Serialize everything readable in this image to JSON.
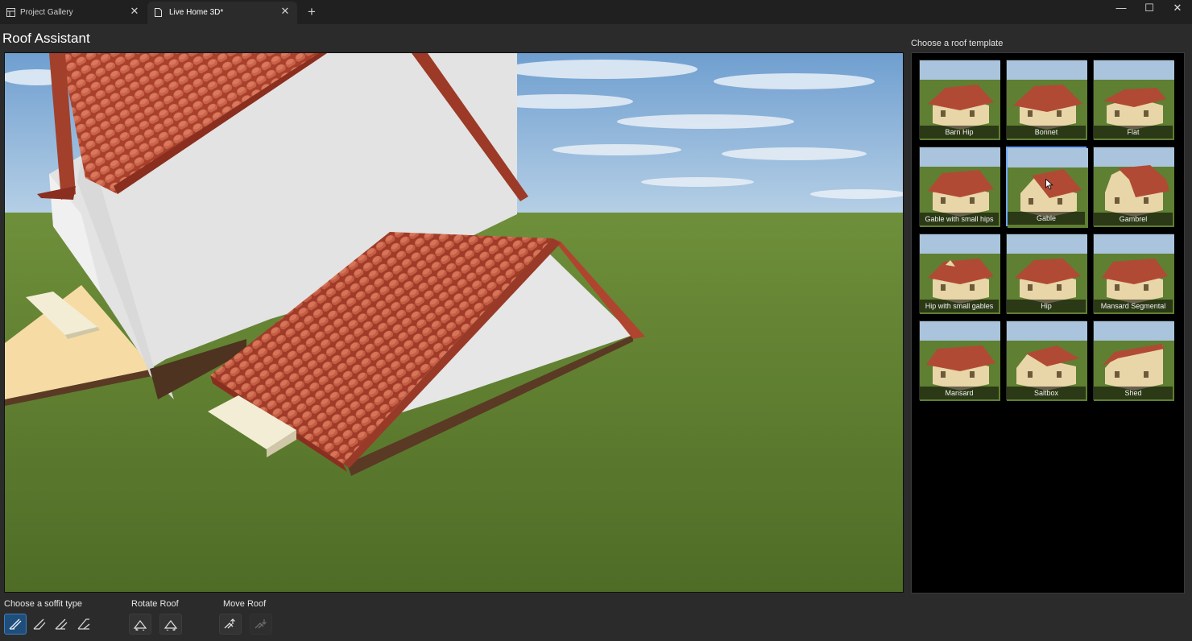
{
  "tabs": [
    {
      "label": "Project Gallery",
      "icon": "gallery-icon",
      "active": false
    },
    {
      "label": "Live Home 3D*",
      "icon": "document-icon",
      "active": true
    }
  ],
  "window_controls": {
    "minimize": "—",
    "maximize": "☐",
    "close": "✕",
    "add_tab": "+",
    "tab_close": "✕"
  },
  "header": {
    "title": "Roof Assistant"
  },
  "template_panel": {
    "title": "Choose a roof template",
    "selected": "Gable",
    "templates": [
      {
        "label": "Barn Hip"
      },
      {
        "label": "Bonnet"
      },
      {
        "label": "Flat"
      },
      {
        "label": "Gable with small hips"
      },
      {
        "label": "Gable"
      },
      {
        "label": "Gambrel"
      },
      {
        "label": "Hip with small gables"
      },
      {
        "label": "Hip"
      },
      {
        "label": "Mansard Segmental"
      },
      {
        "label": "Mansard"
      },
      {
        "label": "Saltbox"
      },
      {
        "label": "Shed"
      }
    ]
  },
  "toolbar": {
    "soffit_label": "Choose a soffit type",
    "rotate_label": "Rotate Roof",
    "move_label": "Move Roof",
    "soffit_options": [
      "soffit-type-1",
      "soffit-type-2",
      "soffit-type-3",
      "soffit-type-4"
    ],
    "selected_soffit": 0
  },
  "colors": {
    "accent": "#3f7fc2",
    "roof_tile": "#b24a35",
    "wall": "#e4e4e4",
    "grass": "#5b7a2f",
    "sky": "#8fb6da"
  }
}
